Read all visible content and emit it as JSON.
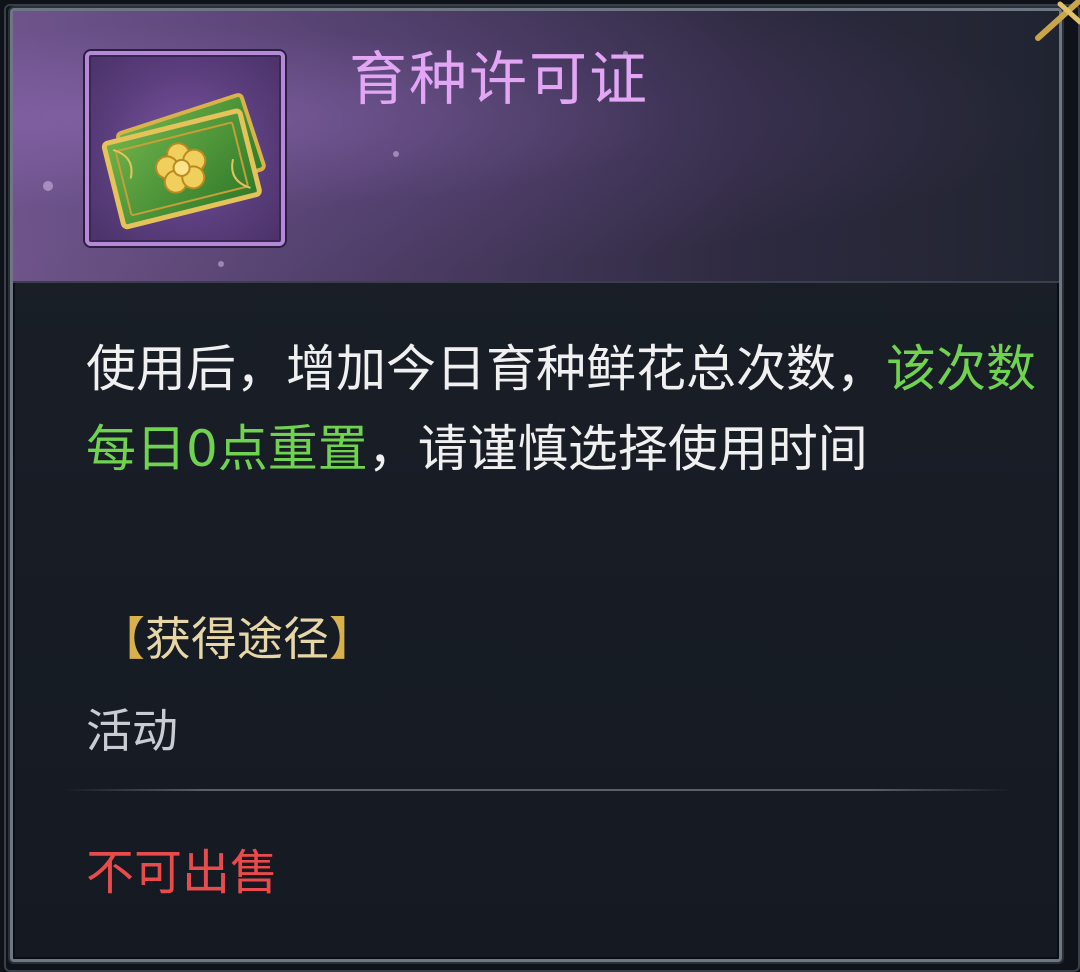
{
  "item": {
    "name": "育种许可证",
    "icon": "green-ticket-with-gold-flower-icon",
    "rarity_color": "#b48ad6"
  },
  "description": {
    "part1": "使用后，增加今日育种鲜花总次数，",
    "highlight": "该次数每日0点重置",
    "part2": "，请谨慎选择使用时间"
  },
  "source": {
    "header_open": "【",
    "header_label": "获得途径",
    "header_close": "】",
    "value": "活动"
  },
  "sell_status": "不可出售",
  "colors": {
    "title": "#e2a6f4",
    "highlight": "#6fd34f",
    "warning": "#e84b4b",
    "source_bracket": "#d8b04c"
  },
  "close": {
    "icon": "close-x-icon"
  }
}
